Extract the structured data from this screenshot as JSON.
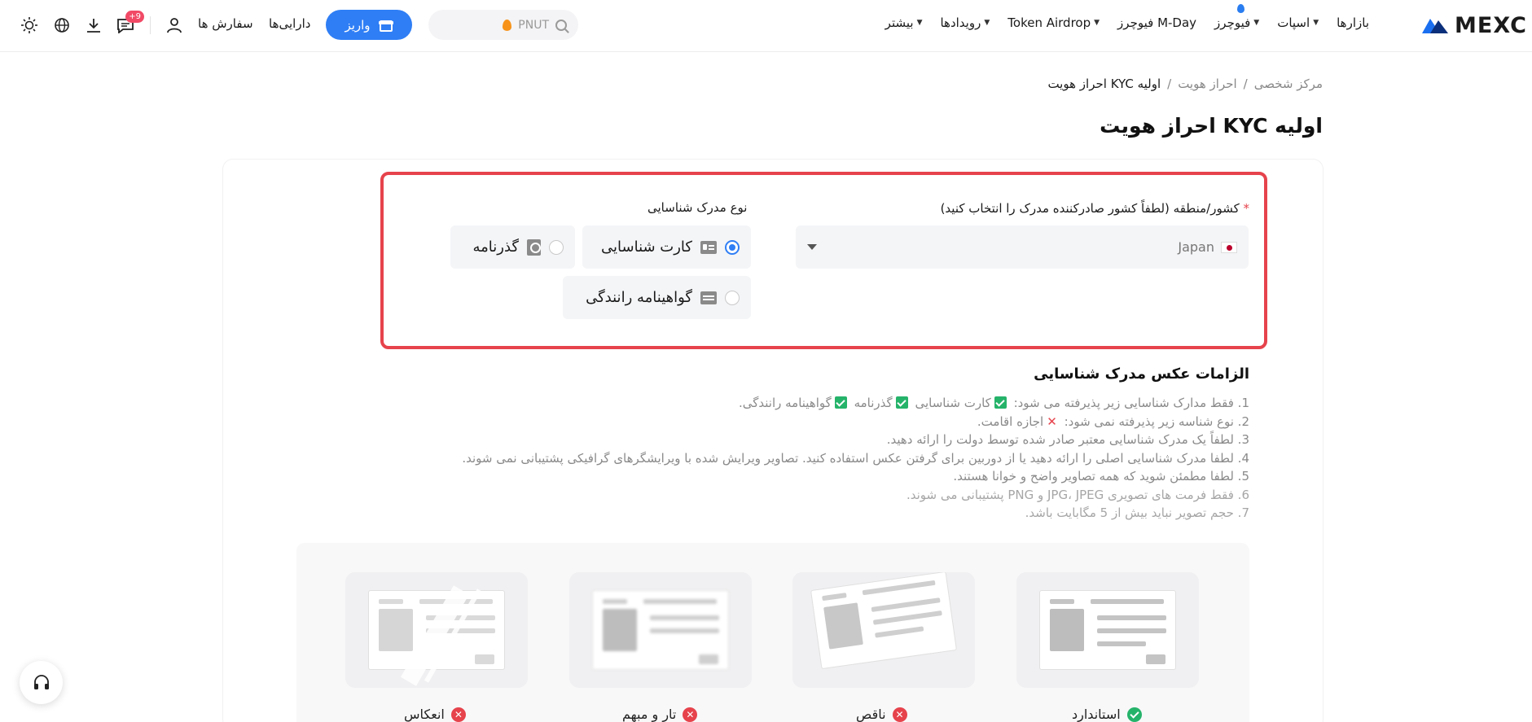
{
  "header": {
    "logo_text": "MEXC",
    "nav": [
      {
        "label": "بازارها",
        "caret": false
      },
      {
        "label": "اسپات",
        "caret": true
      },
      {
        "label": "فیوچرز",
        "caret": true
      },
      {
        "label": "فیوچرز M-Day",
        "caret": false
      },
      {
        "label": "Token Airdrop",
        "caret": true
      },
      {
        "label": "رویدادها",
        "caret": true
      },
      {
        "label": "بیشتر",
        "caret": true
      }
    ],
    "search_value": "PNUT",
    "deposit_label": "واریز",
    "assets_label": "دارایی‌ها",
    "orders_label": "سفارش ها",
    "notification_badge": "+9",
    "accent_color": "#2f7ef5"
  },
  "breadcrumb": {
    "items": [
      "مرکز شخصی",
      "احراز هویت",
      "احراز هویت KYC اولیه"
    ],
    "separator": "/"
  },
  "page_title": "احراز هویت KYC اولیه",
  "form": {
    "country_label": "کشور/منطقه (لطفاً کشور صادرکننده مدرک را انتخاب کنید)",
    "required_mark": "*",
    "country_value": "Japan",
    "doctype_label": "نوع مدرک شناسایی",
    "options": [
      {
        "label": "کارت شناسایی",
        "selected": true,
        "icon": "id-card-icon"
      },
      {
        "label": "گذرنامه",
        "selected": false,
        "icon": "passport-icon"
      },
      {
        "label": "گواهینامه رانندگی",
        "selected": false,
        "icon": "driver-license-icon"
      }
    ]
  },
  "requirements": {
    "title": "الزامات عکس مدرک شناسایی",
    "item1_prefix": "1. فقط مدارک شناسایی زیر پذیرفته می شود:",
    "item1_a": "کارت شناسایی",
    "item1_b": "گذرنامه",
    "item1_c": "گواهینامه رانندگی.",
    "item2_prefix": "2. نوع شناسه زیر پذیرفته نمی شود:",
    "item2_a": "اجازه اقامت.",
    "item3": "3. لطفاً یک مدرک شناسایی معتبر صادر شده توسط دولت را ارائه دهید.",
    "item4": "4. لطفا مدرک شناسایی اصلی را ارائه دهید یا از دوربین برای گرفتن عکس استفاده کنید. تصاویر ویرایش شده با ویرایشگرهای گرافیکی پشتیبانی نمی شوند.",
    "item5": "5. لطفا مطمئن شوید که همه تصاویر واضح و خوانا هستند.",
    "item6": "6. فقط فرمت های تصویری JPG، JPEG و PNG پشتیبانی می شوند.",
    "item7": "7. حجم تصویر نباید بیش از 5 مگابایت باشد."
  },
  "samples": [
    {
      "label": "استاندارد",
      "status": "ok"
    },
    {
      "label": "ناقص",
      "status": "bad"
    },
    {
      "label": "تار و مبهم",
      "status": "bad"
    },
    {
      "label": "انعکاس",
      "status": "bad"
    }
  ]
}
